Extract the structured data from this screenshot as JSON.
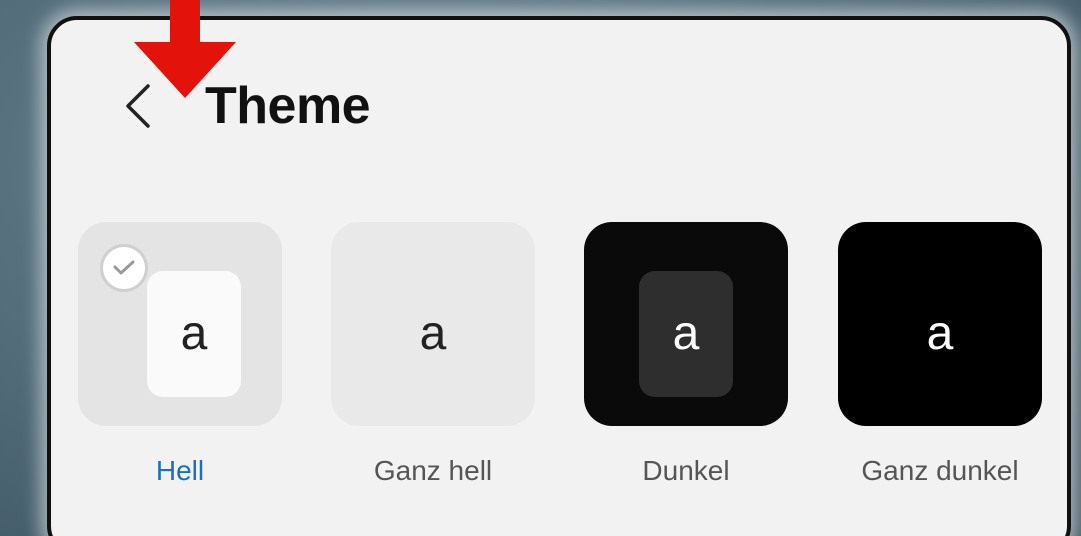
{
  "header": {
    "title": "Theme",
    "back_icon": "chevron-left-icon"
  },
  "annotation": {
    "arrow_icon": "arrow-down-icon",
    "arrow_color": "#e3120b"
  },
  "theme_options": [
    {
      "letter": "a",
      "label": "Hell",
      "selected": true,
      "tile_color": "#e4e4e4",
      "inner_color": "#fafafa",
      "letter_color": "#222222",
      "label_color": "#1a6dc8"
    },
    {
      "letter": "a",
      "label": "Ganz hell",
      "selected": false,
      "tile_color": "#e9e9e9",
      "inner_color": null,
      "letter_color": "#222222",
      "label_color": "#555555"
    },
    {
      "letter": "a",
      "label": "Dunkel",
      "selected": false,
      "tile_color": "#0a0a0a",
      "inner_color": "#2e2e2e",
      "letter_color": "#ffffff",
      "label_color": "#555555"
    },
    {
      "letter": "a",
      "label": "Ganz dunkel",
      "selected": false,
      "tile_color": "#000000",
      "inner_color": null,
      "letter_color": "#ffffff",
      "label_color": "#555555"
    }
  ],
  "check_icon": "check-icon"
}
